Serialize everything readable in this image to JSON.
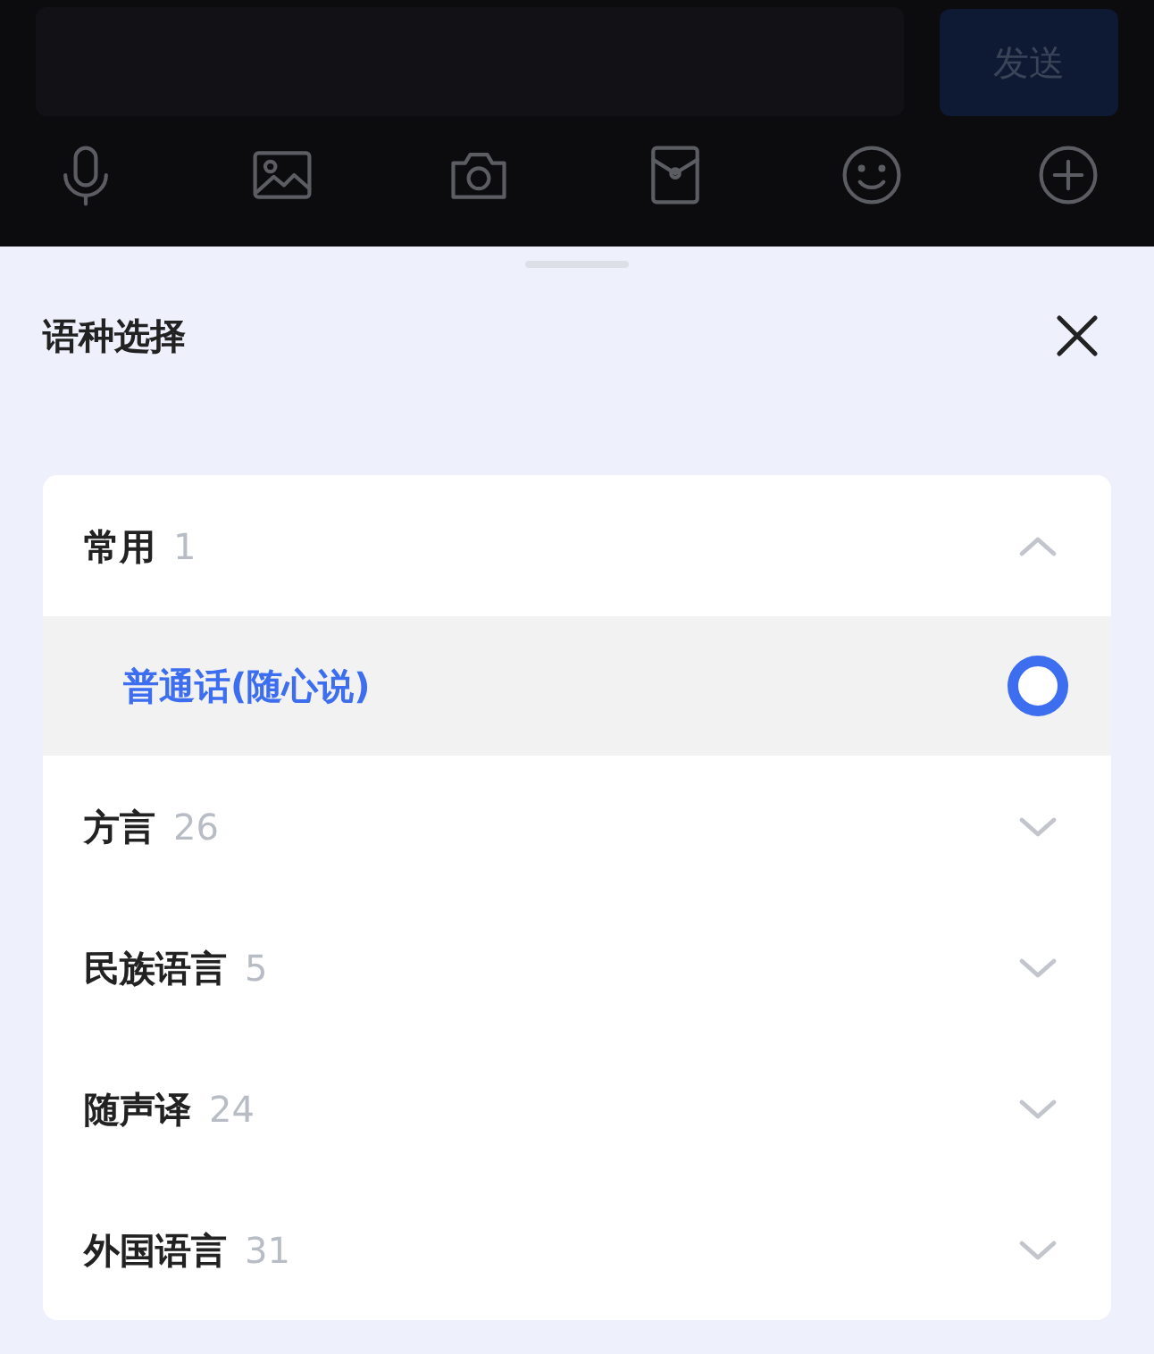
{
  "composer": {
    "send_button": {
      "label": "发送",
      "disabled": true
    },
    "tools": [
      {
        "kind": "mic"
      },
      {
        "kind": "image"
      },
      {
        "kind": "camera"
      },
      {
        "kind": "envelope"
      },
      {
        "kind": "emoji"
      },
      {
        "kind": "plus"
      }
    ]
  },
  "sheet": {
    "title": "语种选择",
    "groups": [
      {
        "label": "常用",
        "count": "1",
        "expanded": true,
        "items": [
          {
            "label": "普通话(随心说)",
            "selected": true
          }
        ]
      },
      {
        "label": "方言",
        "count": "26",
        "expanded": false
      },
      {
        "label": "民族语言",
        "count": "5",
        "expanded": false
      },
      {
        "label": "随声译",
        "count": "24",
        "expanded": false
      },
      {
        "label": "外国语言",
        "count": "31",
        "expanded": false
      }
    ]
  }
}
